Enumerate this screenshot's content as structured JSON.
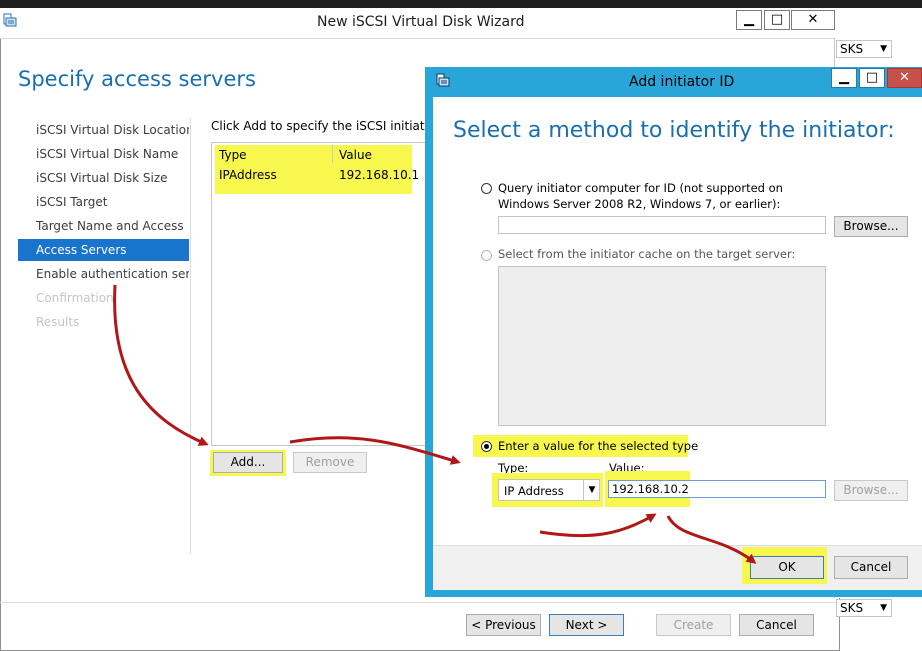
{
  "wizard": {
    "title": "New iSCSI Virtual Disk Wizard",
    "heading": "Specify access servers",
    "nav": [
      {
        "label": "iSCSI Virtual Disk Location"
      },
      {
        "label": "iSCSI Virtual Disk Name"
      },
      {
        "label": "iSCSI Virtual Disk Size"
      },
      {
        "label": "iSCSI Target"
      },
      {
        "label": "Target Name and Access"
      },
      {
        "label": "Access Servers"
      },
      {
        "label": "Enable authentication ser..."
      },
      {
        "label": "Confirmation"
      },
      {
        "label": "Results"
      }
    ],
    "instruction": "Click Add to specify the iSCSI initiator(s)",
    "table": {
      "columns": [
        "Type",
        "Value"
      ],
      "rows": [
        [
          "IPAddress",
          "192.168.10.1"
        ]
      ]
    },
    "add_label": "Add...",
    "remove_label": "Remove",
    "previous_label": "< Previous",
    "next_label": "Next >",
    "create_label": "Create",
    "cancel_label": "Cancel"
  },
  "background": {
    "combo_top": "SKS",
    "combo_bottom": "SKS"
  },
  "caption": {
    "minimize": "▁",
    "maximize": "□",
    "close": "✕"
  },
  "dialog": {
    "title": "Add initiator ID",
    "heading": "Select a method to identify the initiator:",
    "option_query": "Query initiator computer for ID (not supported on Windows Server 2008 R2, Windows 7, or earlier):",
    "option_cache": "Select from the initiator cache on the target server:",
    "option_value": "Enter a value for the selected type",
    "browse_label": "Browse...",
    "type_label": "Type:",
    "value_label": "Value:",
    "type_value": "IP Address",
    "value_input": "192.168.10.2",
    "ok_label": "OK",
    "cancel_label": "Cancel"
  },
  "colors": {
    "accent": "#1874cd",
    "dialog_border": "#2aa5d9",
    "highlight": "#f7f74e",
    "arrow": "#b01818"
  }
}
